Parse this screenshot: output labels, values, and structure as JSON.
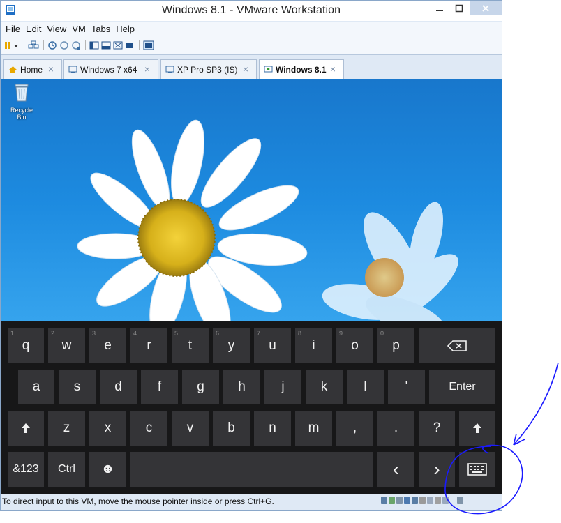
{
  "window": {
    "title": "Windows 8.1 - VMware Workstation"
  },
  "menu": [
    "File",
    "Edit",
    "View",
    "VM",
    "Tabs",
    "Help"
  ],
  "tabs": [
    {
      "label": "Home",
      "icon": "home-icon"
    },
    {
      "label": "Windows 7 x64",
      "icon": "vm-icon"
    },
    {
      "label": "XP Pro SP3 (IS)",
      "icon": "vm-icon"
    },
    {
      "label": "Windows 8.1",
      "icon": "vm-running-icon",
      "active": true
    }
  ],
  "desktop": {
    "recycle_bin_label": "Recycle Bin"
  },
  "keyboard": {
    "row1": [
      {
        "label": "q",
        "num": "1"
      },
      {
        "label": "w",
        "num": "2"
      },
      {
        "label": "e",
        "num": "3"
      },
      {
        "label": "r",
        "num": "4"
      },
      {
        "label": "t",
        "num": "5"
      },
      {
        "label": "y",
        "num": "6"
      },
      {
        "label": "u",
        "num": "7"
      },
      {
        "label": "i",
        "num": "8"
      },
      {
        "label": "o",
        "num": "9"
      },
      {
        "label": "p",
        "num": "0"
      }
    ],
    "row2": [
      "a",
      "s",
      "d",
      "f",
      "g",
      "h",
      "j",
      "k",
      "l",
      "'"
    ],
    "enter": "Enter",
    "row3": [
      "z",
      "x",
      "c",
      "v",
      "b",
      "n",
      "m",
      ",",
      ".",
      "?"
    ],
    "num_key": "&123",
    "ctrl_key": "Ctrl",
    "emoji_key": "☻",
    "left_arrow": "‹",
    "right_arrow": "›"
  },
  "status": {
    "text": "To direct input to this VM, move the mouse pointer inside or press Ctrl+G."
  },
  "colors": {
    "annotation": "#1a1aff",
    "key_bg": "#343437",
    "keyboard_bg": "#171718"
  }
}
